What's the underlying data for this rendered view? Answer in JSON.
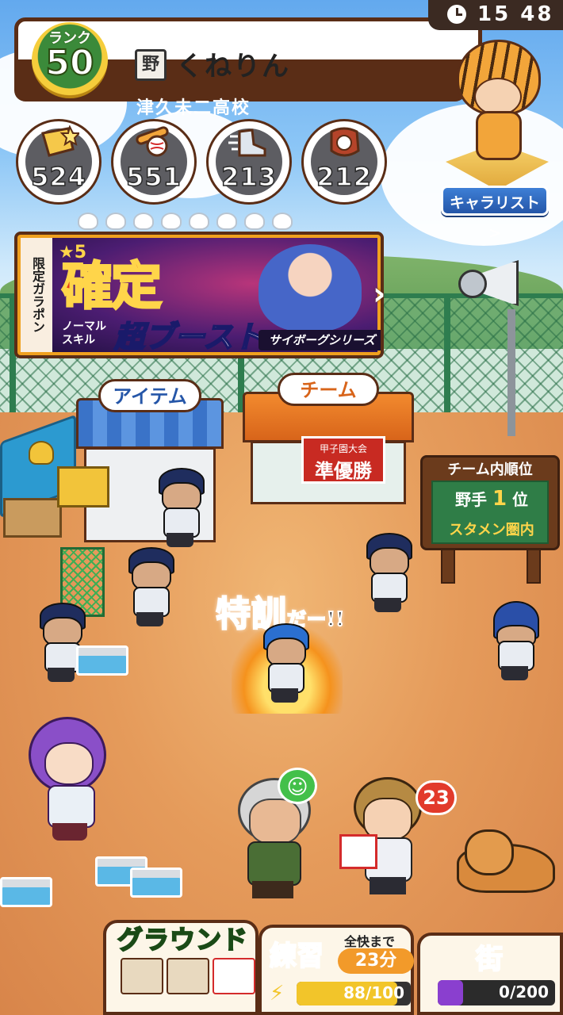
{
  "header": {
    "rank_label": "ランク",
    "rank_value": "50",
    "position_kanji": "野",
    "player_name": "くねりん",
    "school_name": "津久未二高校"
  },
  "clock": {
    "time": "15 48"
  },
  "stats": [
    {
      "icon": "batting-icon",
      "value": "524"
    },
    {
      "icon": "power-icon",
      "value": "551"
    },
    {
      "icon": "speed-icon",
      "value": "213"
    },
    {
      "icon": "glove-icon",
      "value": "212"
    }
  ],
  "mascot": {
    "button_label": "キャラリスト >"
  },
  "gacha_banner": {
    "side_label": "限定ガラポン",
    "star_label": "★5",
    "title": "確定",
    "skill_label": "ノーマル スキル",
    "boost_label": "超ブースト",
    "series_label": "サイボーグシリーズ",
    "arrow": "›"
  },
  "item_shop": {
    "label": "アイテム"
  },
  "team_shop": {
    "label": "チーム",
    "banner_top": "甲子園大会",
    "banner_main": "準優勝"
  },
  "team_rank_board": {
    "title": "チーム内順位",
    "position": "野手",
    "rank_number": "1",
    "rank_suffix": "位",
    "status": "スタメン圏内"
  },
  "training_callout": {
    "main": "特訓",
    "tail": "だー!!"
  },
  "notifications": {
    "scout_badge": "23"
  },
  "bottom_nav": {
    "ground": {
      "label": "グラウンド"
    },
    "practice": {
      "title": "練習",
      "until_label": "全快まで",
      "time_left": "23分",
      "current": 88,
      "max": 100,
      "count_text": "88/100"
    },
    "town": {
      "title": "街",
      "current": 0,
      "max": 200,
      "count_text": "0/200"
    }
  },
  "colors": {
    "frame_brown": "#5a2d16",
    "accent_green": "#3b8a3a",
    "accent_blue": "#2556a8",
    "accent_red": "#e23a2b"
  }
}
